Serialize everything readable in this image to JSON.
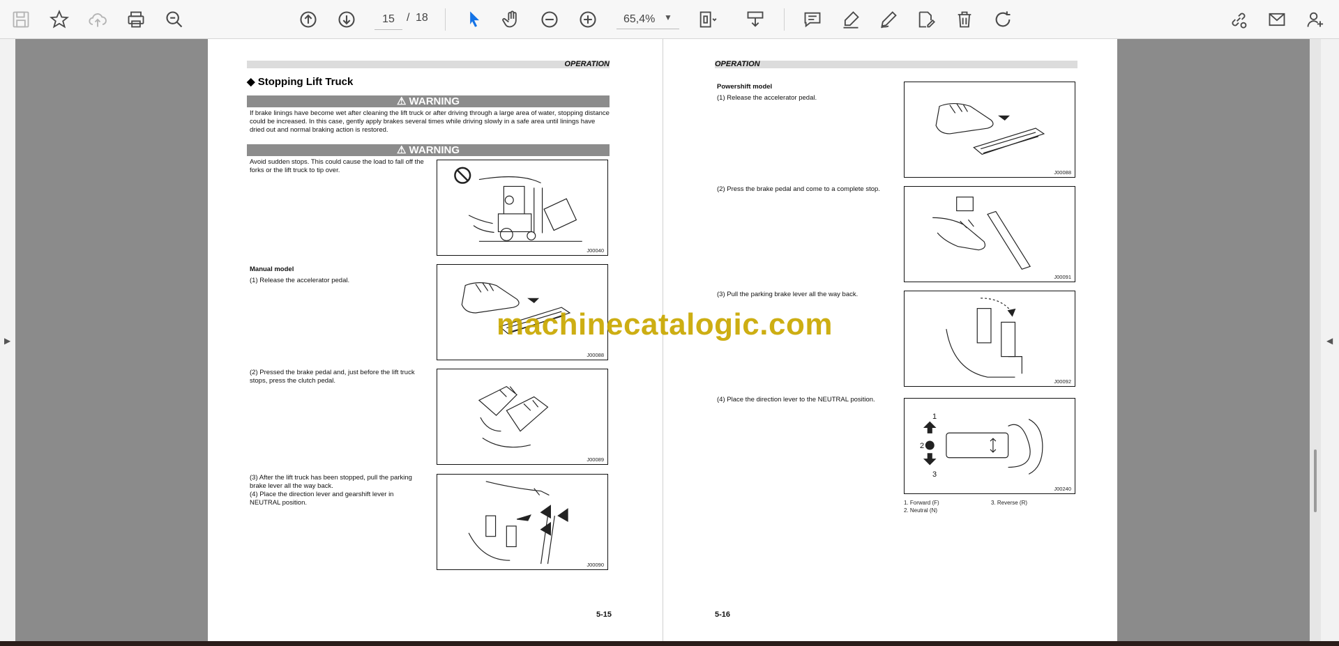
{
  "toolbar": {
    "page_current": "15",
    "page_separator": "/",
    "page_total": "18",
    "zoom": "65,4%",
    "icons": [
      "save-icon",
      "bookmark-star-icon",
      "cloud-upload-icon",
      "print-icon",
      "zoom-search-icon",
      "page-up-icon",
      "page-down-icon",
      "select-cursor-icon",
      "hand-tool-icon",
      "zoom-out-icon",
      "zoom-in-icon",
      "fit-page-icon",
      "scroll-mode-icon",
      "comment-icon",
      "highlight-icon",
      "draw-icon",
      "fill-sign-icon",
      "delete-icon",
      "rotate-icon",
      "share-link-icon",
      "email-icon",
      "add-user-icon"
    ]
  },
  "left_page": {
    "header": "OPERATION",
    "title": "◆ Stopping Lift Truck",
    "warning1_label": "⚠ WARNING",
    "warning1_text": "If brake linings have become wet after cleaning the lift truck or after driving through a large area of water, stopping distance could be increased. In this case, gently apply brakes several times while driving slowly in a safe area until linings have dried out and normal braking action is restored.",
    "warning2_label": "⚠ WARNING",
    "warning2_text": "Avoid sudden stops. This could cause the load to fall off the forks or the lift truck to tip over.",
    "manual_heading": "Manual model",
    "step1": "(1)    Release the accelerator pedal.",
    "step2": "(2)    Pressed the brake pedal and, just before the lift truck stops, press the clutch pedal.",
    "step3": "(3)    After the lift truck has been stopped, pull the parking brake lever all the way back.",
    "step4": "(4)    Place the direction lever and gearshift lever in NEUTRAL position.",
    "fig1_code": "J00040",
    "fig2_code": "J00088",
    "fig3_code": "J00089",
    "fig4_code": "J00090",
    "page_number": "5-15"
  },
  "right_page": {
    "header": "OPERATION",
    "powershift_heading": "Powershift model",
    "step1": "(1)    Release the accelerator pedal.",
    "step2": "(2)    Press the brake pedal and come to a complete stop.",
    "step3": "(3)    Pull the parking brake lever all the way back.",
    "step4": "(4)    Place the direction lever to the NEUTRAL position.",
    "fig1_code": "J00088",
    "fig2_code": "J00091",
    "fig3_code": "J00092",
    "fig4_code": "J00240",
    "fig4_label1": "1",
    "fig4_label2": "2",
    "fig4_label3": "3",
    "caption1": "1. Forward (F)",
    "caption2": "2. Neutral (N)",
    "caption3": "3. Reverse (R)",
    "page_number": "5-16"
  },
  "watermark": "machinecatalogic.com"
}
